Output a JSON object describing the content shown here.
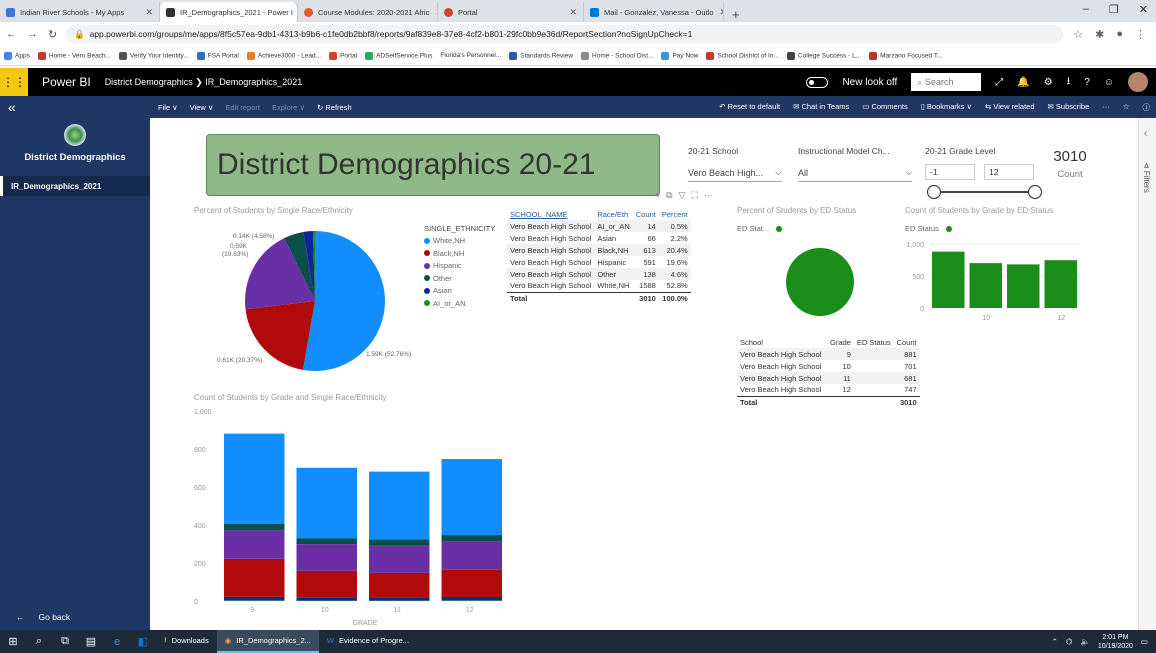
{
  "browser": {
    "tabs": [
      {
        "label": "Indian River Schools - My Apps",
        "color": "#3c78d8"
      },
      {
        "label": "IR_Demographics_2021 - Power I",
        "color": "#333333"
      },
      {
        "label": "Course Modules: 2020-2021 Afric",
        "color": "#e05a2b"
      },
      {
        "label": "Portal",
        "color": "#d4442b"
      },
      {
        "label": "Mail - Gonzalez, Vanessa - Outlo",
        "color": "#0078d4"
      }
    ],
    "url": "app.powerbi.com/groups/me/apps/8f5c57ea-9db1-4313-b9b6-c1fe0db2bbf8/reports/9af839e8-37e8-4cf2-b801-29fc0bb9e36d/ReportSection?noSignUpCheck=1",
    "bookmarks": [
      "Apps",
      "Home - Vero Beach...",
      "Verify Your Identity...",
      "FSA Portal",
      "Achieve3000 - Lead...",
      "Portal",
      "ADSelfService Plus",
      "Florida's Personnel...",
      "Standards Review",
      "Home - School Dist...",
      "Pay Now",
      "School District of In...",
      "College Success - L...",
      "Marzano Focused T..."
    ]
  },
  "powerbi": {
    "app_name": "Power BI",
    "breadcrumb": "District Demographics  ❯  IR_Demographics_2021",
    "new_look": "New look off",
    "search_placeholder": "Search"
  },
  "actionbar": {
    "left": [
      "File ∨",
      "View ∨",
      "Edit report",
      "Explore ∨",
      "Refresh"
    ],
    "right": [
      "Reset to default",
      "Chat in Teams",
      "Comments",
      "Bookmarks ∨",
      "View related",
      "Subscribe"
    ]
  },
  "sidebar": {
    "title": "District Demographics",
    "item": "IR_Demographics_2021",
    "go_back": "Go back"
  },
  "report": {
    "title": "District Demographics 20-21",
    "school_slicer": {
      "label": "20-21 School",
      "value": "Vero Beach High..."
    },
    "model_slicer": {
      "label": "Instructional Model Ch...",
      "value": "All"
    },
    "grade_slicer": {
      "label": "20-21 Grade Level",
      "min": "-1",
      "max": "12"
    },
    "count_card": {
      "value": "3010",
      "label": "Count"
    },
    "pie_title": "Percent of Students by Single Race/Ethnicity",
    "pie_legend_title": "SINGLE_ETHNICITY",
    "pie_labels": [
      "0.14K (4.58%)",
      "0.59K",
      "(19.63%)",
      "1.59K (52.76%)",
      "0.61K (20.37%)"
    ],
    "ed_title": "Percent of Students by ED Status",
    "ed_legend": "ED Stat...",
    "gradebar_title": "Count of Students by Grade by ED Status",
    "gradebar_legend": "ED Status",
    "stack_title": "Count of Students by Grade and Single Race/Ethnicity",
    "stack_xlabel": "GRADE"
  },
  "race_table": {
    "headers": [
      "SCHOOL_NAME",
      "Race/Eth",
      "Count",
      "Percent"
    ],
    "rows": [
      [
        "Vero Beach High School",
        "AI_or_AN",
        "14",
        "0.5%"
      ],
      [
        "Vero Beach High School",
        "Asian",
        "66",
        "2.2%"
      ],
      [
        "Vero Beach High School",
        "Black,NH",
        "613",
        "20.4%"
      ],
      [
        "Vero Beach High School",
        "Hispanic",
        "591",
        "19.6%"
      ],
      [
        "Vero Beach High School",
        "Other",
        "138",
        "4.6%"
      ],
      [
        "Vero Beach High School",
        "White,NH",
        "1588",
        "52.8%"
      ]
    ],
    "total": [
      "Total",
      "",
      "3010",
      "100.0%"
    ]
  },
  "grade_table": {
    "headers": [
      "School",
      "Grade",
      "ED Status",
      "Count"
    ],
    "rows": [
      [
        "Vero Beach High School",
        "9",
        "",
        "881"
      ],
      [
        "Vero Beach High School",
        "10",
        "",
        "701"
      ],
      [
        "Vero Beach High School",
        "11",
        "",
        "681"
      ],
      [
        "Vero Beach High School",
        "12",
        "",
        "747"
      ]
    ],
    "total": [
      "Total",
      "",
      "",
      "3010"
    ]
  },
  "taskbar": {
    "apps": [
      "Downloads",
      "IR_Demographics_2...",
      "Evidence of Progre..."
    ],
    "time": "2:01 PM",
    "date": "10/19/2020"
  },
  "chart_data": [
    {
      "type": "pie",
      "title": "Percent of Students by Single Race/Ethnicity",
      "legend_title": "SINGLE_ETHNICITY",
      "categories": [
        "White,NH",
        "Black,NH",
        "Hispanic",
        "Other",
        "Asian",
        "AI_or_AN"
      ],
      "values": [
        1588,
        613,
        591,
        138,
        66,
        14
      ],
      "colors": [
        "#118dff",
        "#b10a0a",
        "#6b2fa5",
        "#0b4f4a",
        "#12239e",
        "#1a8d1a"
      ]
    },
    {
      "type": "pie",
      "title": "Percent of Students by ED Status",
      "legend_title": "ED Stat...",
      "categories": [
        ""
      ],
      "values": [
        3010
      ],
      "colors": [
        "#1a8d1a"
      ]
    },
    {
      "type": "bar",
      "title": "Count of Students by Grade by ED Status",
      "categories": [
        "9",
        "10",
        "11",
        "12"
      ],
      "x_ticks_shown": [
        "10",
        "12"
      ],
      "values": [
        881,
        701,
        681,
        747
      ],
      "ylim": [
        0,
        1000
      ],
      "yticks": [
        0,
        500,
        1000
      ],
      "color": "#1a8d1a"
    },
    {
      "type": "bar",
      "stacked": true,
      "title": "Count of Students by Grade and Single Race/Ethnicity",
      "xlabel": "GRADE",
      "categories": [
        "9",
        "10",
        "11",
        "12"
      ],
      "ylim": [
        0,
        1000
      ],
      "yticks": [
        0,
        200,
        400,
        600,
        800,
        1000
      ],
      "series": [
        {
          "name": "AI_or_AN",
          "color": "#1a8d1a",
          "values": [
            4,
            3,
            3,
            4
          ]
        },
        {
          "name": "Asian",
          "color": "#12239e",
          "values": [
            18,
            16,
            15,
            17
          ]
        },
        {
          "name": "Black,NH",
          "color": "#b10a0a",
          "values": [
            200,
            140,
            130,
            143
          ]
        },
        {
          "name": "Hispanic",
          "color": "#6b2fa5",
          "values": [
            150,
            140,
            143,
            150
          ]
        },
        {
          "name": "Other",
          "color": "#0b4f4a",
          "values": [
            35,
            30,
            33,
            33
          ]
        },
        {
          "name": "White,NH",
          "color": "#118dff",
          "values": [
            474,
            372,
            357,
            400
          ]
        }
      ]
    }
  ]
}
